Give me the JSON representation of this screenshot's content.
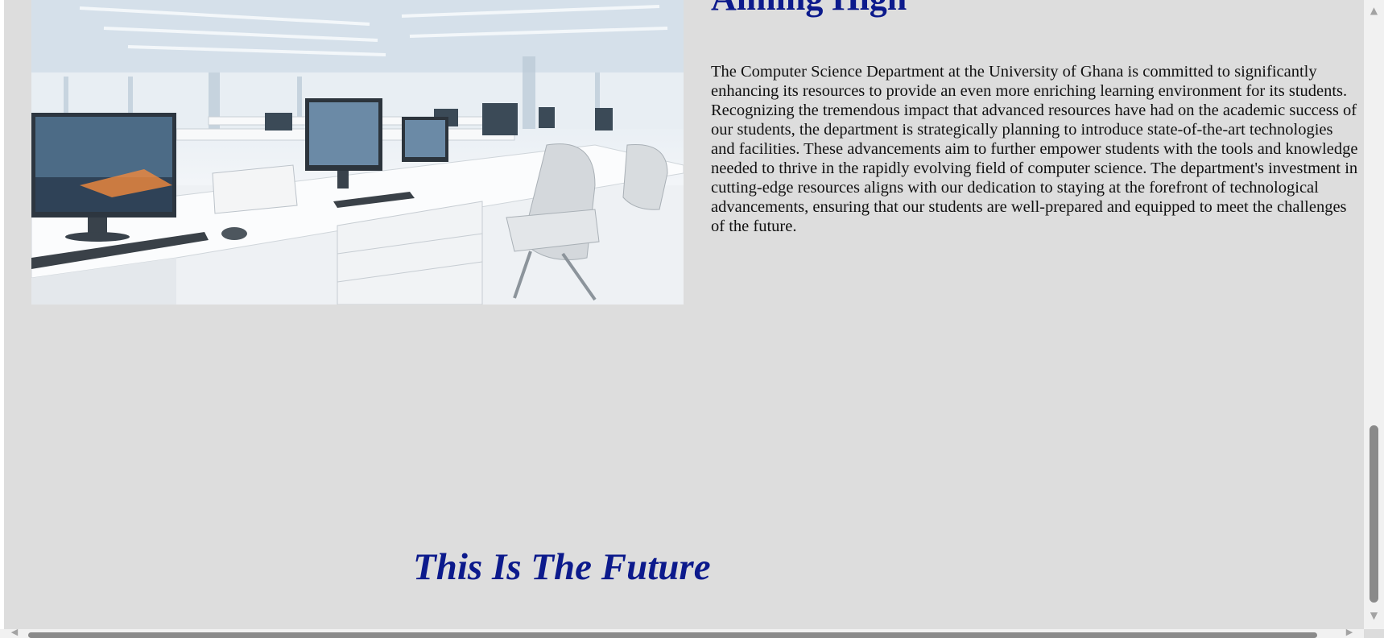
{
  "section": {
    "heading": "Aiming High",
    "image_alt": "Modern computer lab with white desks and monitors",
    "body": "The Computer Science Department at the University of Ghana is committed to significantly enhancing its resources to provide an even more enriching learning environment for its students. Recognizing the tremendous impact that advanced resources have had on the academic success of our students, the department is strategically planning to introduce state-of-the-art technologies and facilities. These advancements aim to further empower students with the tools and knowledge needed to thrive in the rapidly evolving field of computer science. The department's investment in cutting-edge resources aligns with our dedication to staying at the forefront of technological advancements, ensuring that our students are well-prepared and equipped to meet the challenges of the future."
  },
  "future": {
    "heading": "This Is The Future"
  },
  "scrollbars": {
    "up_icon": "▲",
    "down_icon": "▼",
    "left_icon": "◀",
    "right_icon": "▶"
  },
  "colors": {
    "heading": "#0c1a8c",
    "page_background": "#dddddd"
  }
}
